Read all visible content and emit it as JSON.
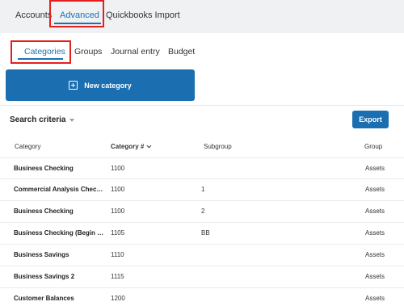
{
  "top_tabs": [
    {
      "label": "Accounts"
    },
    {
      "label": "Advanced"
    },
    {
      "label": "Quickbooks Import"
    }
  ],
  "sub_tabs": [
    {
      "label": "Categories"
    },
    {
      "label": "Groups"
    },
    {
      "label": "Journal entry"
    },
    {
      "label": "Budget"
    }
  ],
  "new_category_label": "New category",
  "search_criteria_label": "Search criteria",
  "export_label": "Export",
  "table": {
    "headers": {
      "category": "Category",
      "number": "Category #",
      "subgroup": "Subgroup",
      "group": "Group"
    },
    "rows": [
      {
        "category": "Business Checking",
        "number": "1100",
        "subgroup": "",
        "group": "Assets"
      },
      {
        "category": "Commercial Analysis Checking",
        "number": "1100",
        "subgroup": "1",
        "group": "Assets"
      },
      {
        "category": "Business Checking",
        "number": "1100",
        "subgroup": "2",
        "group": "Assets"
      },
      {
        "category": "Business Checking (Begin Bal...",
        "number": "1105",
        "subgroup": "BB",
        "group": "Assets"
      },
      {
        "category": "Business Savings",
        "number": "1110",
        "subgroup": "",
        "group": "Assets"
      },
      {
        "category": "Business Savings 2",
        "number": "1115",
        "subgroup": "",
        "group": "Assets"
      },
      {
        "category": "Customer Balances",
        "number": "1200",
        "subgroup": "",
        "group": "Assets"
      }
    ]
  },
  "colors": {
    "accent": "#1b72b3",
    "button": "#1b6fb0",
    "highlight": "#e2201e",
    "page_bg": "#eff1f3"
  },
  "icons": {
    "new_category": "plus-square-icon",
    "search_criteria": "caret-down-icon",
    "sort": "chevron-down-icon"
  }
}
